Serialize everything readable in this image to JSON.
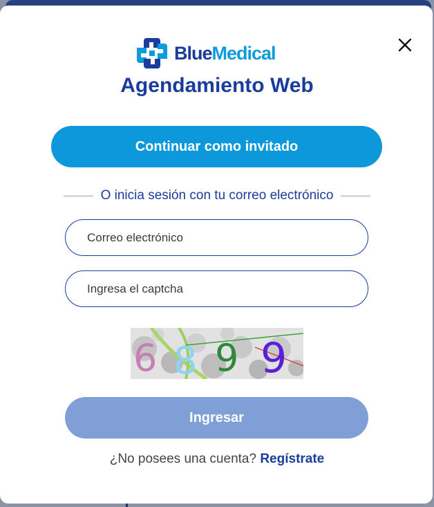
{
  "brand": {
    "name_part1": "Blue",
    "name_part2": "Medical"
  },
  "modal": {
    "title": "Agendamiento Web",
    "close_icon": "close-icon",
    "guest_button_label": "Continuar como invitado",
    "divider_text": "O inicia sesión con tu correo electrónico",
    "email_placeholder": "Correo electrónico",
    "captcha_placeholder": "Ingresa el captcha",
    "captcha_code": "6899",
    "submit_label": "Ingresar",
    "register_prompt": "¿No posees una cuenta?",
    "register_link": "Regístrate"
  },
  "colors": {
    "primary_blue": "#1a3c9c",
    "accent_cyan": "#0c98db",
    "disabled_button": "#7f9fd6"
  }
}
